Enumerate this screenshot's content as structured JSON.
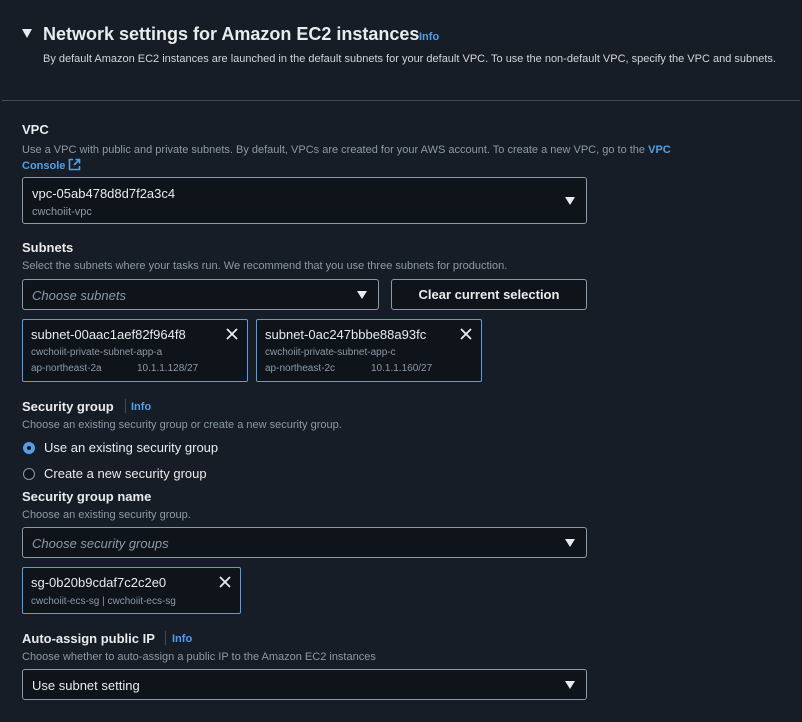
{
  "section": {
    "title": "Network settings for Amazon EC2 instances",
    "info": "Info",
    "description": "By default Amazon EC2 instances are launched in the default subnets for your default VPC. To use the non-default VPC, specify the VPC and subnets."
  },
  "vpc": {
    "label": "VPC",
    "description": "Use a VPC with public and private subnets. By default, VPCs are created for your AWS account. To create a new VPC, go to the",
    "link_part1": "VPC",
    "link_part2": "Console",
    "value": "vpc-05ab478d8d7f2a3c4",
    "sublabel": "cwchoiit-vpc"
  },
  "subnets": {
    "label": "Subnets",
    "description": "Select the subnets where your tasks run. We recommend that you use three subnets for production.",
    "placeholder": "Choose subnets",
    "clear_button": "Clear current selection",
    "selected": [
      {
        "id": "subnet-00aac1aef82f964f8",
        "name": "cwchoiit-private-subnet-app-a",
        "az": "ap-northeast-2a",
        "cidr": "10.1.1.128/27"
      },
      {
        "id": "subnet-0ac247bbbe88a93fc",
        "name": "cwchoiit-private-subnet-app-c",
        "az": "ap-northeast-2c",
        "cidr": "10.1.1.160/27"
      }
    ]
  },
  "security_group": {
    "label": "Security group",
    "info": "Info",
    "description": "Choose an existing security group or create a new security group.",
    "options": [
      "Use an existing security group",
      "Create a new security group"
    ],
    "selected_option": "Use an existing security group",
    "name_label": "Security group name",
    "name_description": "Choose an existing security group.",
    "placeholder": "Choose security groups",
    "selected": {
      "id": "sg-0b20b9cdaf7c2c2e0",
      "name": "cwchoiit-ecs-sg | cwchoiit-ecs-sg"
    }
  },
  "public_ip": {
    "label": "Auto-assign public IP",
    "info": "Info",
    "description": "Choose whether to auto-assign a public IP to the Amazon EC2 instances",
    "value": "Use subnet setting"
  },
  "colors": {
    "background": "#161d26",
    "input_bg": "#0f141a",
    "accent": "#539fe5",
    "text": "#e9ebed",
    "muted": "#8d99a8"
  }
}
